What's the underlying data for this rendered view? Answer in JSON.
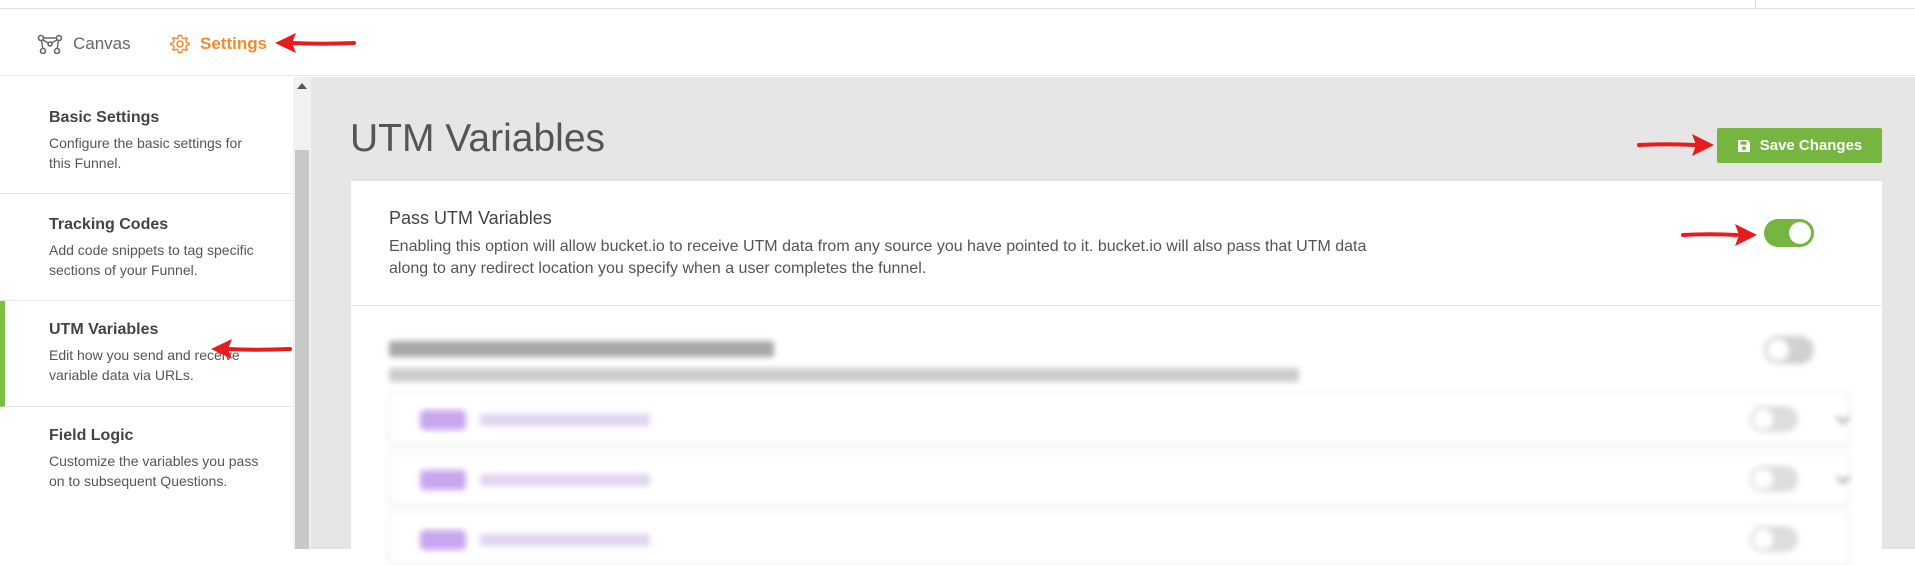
{
  "nav": {
    "tabs": [
      {
        "label": "Canvas",
        "icon": "canvas-icon",
        "active": false
      },
      {
        "label": "Settings",
        "icon": "gear-icon",
        "active": true
      }
    ]
  },
  "sidebar": {
    "items": [
      {
        "title": "Basic Settings",
        "desc": "Configure the basic settings for this Funnel."
      },
      {
        "title": "Tracking Codes",
        "desc": "Add code snippets to tag specific sections of your Funnel."
      },
      {
        "title": "UTM Variables",
        "desc": "Edit how you send and receive variable data via URLs.",
        "active": true
      },
      {
        "title": "Field Logic",
        "desc": "Customize the variables you pass on to subsequent Questions."
      }
    ]
  },
  "main": {
    "title": "UTM Variables",
    "save_label": "Save Changes",
    "pass_utm": {
      "title": "Pass UTM Variables",
      "desc": "Enabling this option will allow bucket.io to receive UTM data from any source you have pointed to it. bucket.io will also pass that UTM data along to any redirect location you specify when a user completes the funnel.",
      "enabled": true
    },
    "blurred_toggle_enabled": false
  },
  "colors": {
    "accent_orange": "#ef8c33",
    "accent_green": "#76b53f",
    "annotation_red": "#e81c1c"
  }
}
